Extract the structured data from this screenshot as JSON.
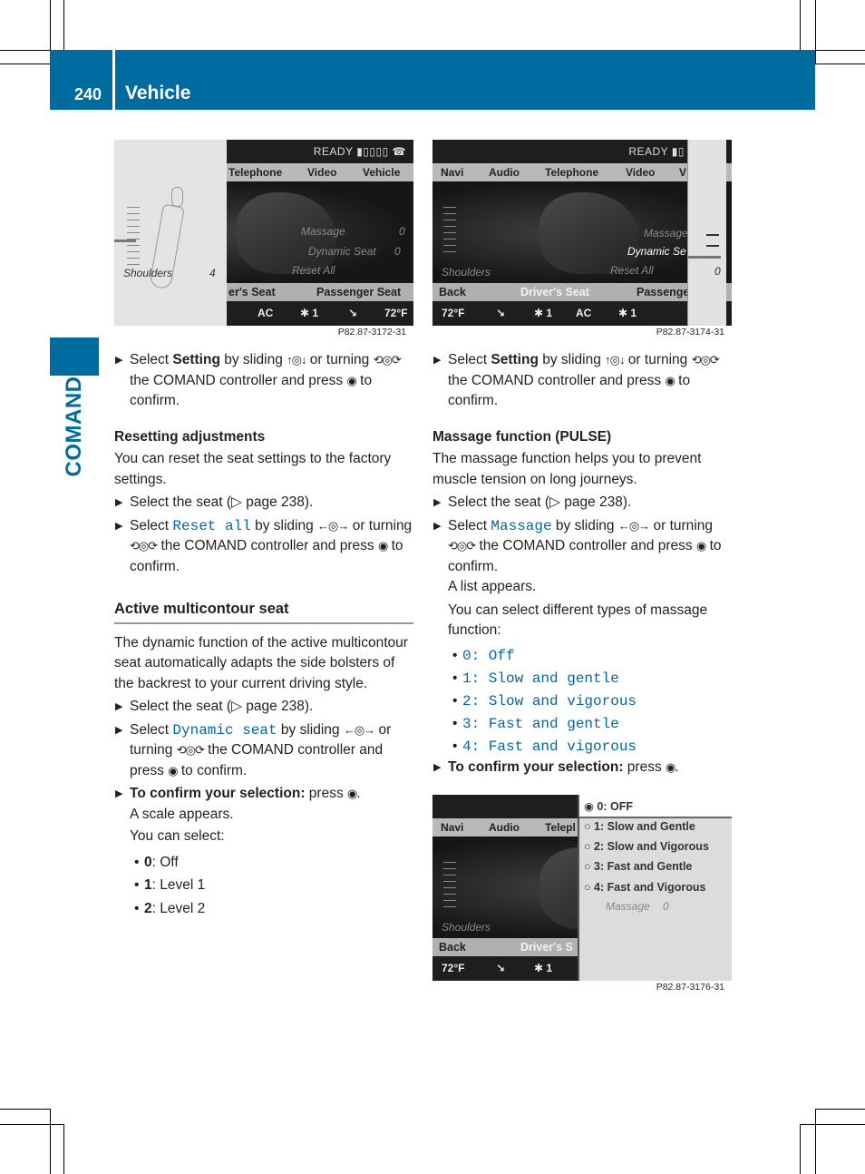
{
  "header": {
    "page_number": "240",
    "section_title": "Vehicle",
    "side_tab_label": "COMAND",
    "accent_color": "#006b9f",
    "link_color": "#0068a0"
  },
  "figures": {
    "fig1": {
      "caption": "P82.87-3172-31",
      "status": "READY",
      "menu": [
        "Telephone",
        "Video",
        "Vehicle"
      ],
      "overlay_label": "Shoulders",
      "overlay_value": "4",
      "items": [
        {
          "label": "Massage",
          "value": "0"
        },
        {
          "label": "Dynamic Seat",
          "value": "0"
        },
        {
          "label": "Reset All",
          "value": ""
        }
      ],
      "seat_bar": [
        "er's Seat",
        "Passenger Seat"
      ],
      "climate": [
        "AC",
        "✱ 1",
        "72°F"
      ]
    },
    "fig2": {
      "caption": "P82.87-3174-31",
      "status": "READY",
      "menu": [
        "Navi",
        "Audio",
        "Telephone",
        "Video",
        "V"
      ],
      "shoulders_label": "Shoulders",
      "items": [
        {
          "label": "Massage",
          "value": ""
        },
        {
          "label": "Dynamic Se",
          "value": ""
        },
        {
          "label": "Reset All",
          "value": ""
        }
      ],
      "overlay_value": "0",
      "seat_bar": [
        "Back",
        "Driver's Seat",
        "Passenge"
      ],
      "climate": [
        "72°F",
        "✱ 1",
        "AC",
        "✱ 1"
      ]
    },
    "fig3": {
      "caption": "P82.87-3176-31",
      "menu": [
        "Navi",
        "Audio",
        "Telepl"
      ],
      "shoulders_label": "Shoulders",
      "seat_bar": [
        "Back",
        "Driver's S"
      ],
      "climate": [
        "72°F",
        "✱ 1"
      ],
      "options": [
        {
          "label": "0: OFF",
          "selected": true
        },
        {
          "label": "1: Slow and Gentle",
          "selected": false
        },
        {
          "label": "2: Slow and Vigorous",
          "selected": false
        },
        {
          "label": "3: Fast and Gentle",
          "selected": false
        },
        {
          "label": "4: Fast and Vigorous",
          "selected": false
        }
      ],
      "footer_label": "Massage",
      "footer_value": "0"
    }
  },
  "left": {
    "step1": {
      "pre": "Select ",
      "bold": "Setting",
      "mid": " by sliding ",
      "after": " or turning ",
      "line2": " the COMAND controller and press ",
      "end": " to confirm."
    },
    "reset_heading": "Resetting adjustments",
    "reset_intro": "You can reset the seat settings to the factory settings.",
    "reset_step1": "Select the seat (▷ page 238).",
    "reset_step2": {
      "pre": "Select ",
      "code": "Reset all",
      "mid": " by sliding ",
      "after": " or turning ",
      "line2": " the COMAND controller and press ",
      "end": " to confirm."
    },
    "amc_heading": "Active multicontour seat",
    "amc_intro": "The dynamic function of the active multicontour seat automatically adapts the side bolsters of the backrest to your current driving style.",
    "amc_step1": "Select the seat (▷ page 238).",
    "amc_step2": {
      "pre": "Select ",
      "code": "Dynamic seat",
      "mid": " by sliding ",
      "after": " or turning ",
      "line2": " the COMAND controller and press ",
      "end": " to confirm."
    },
    "amc_confirm": {
      "bold": "To confirm your selection:",
      "rest": " press "
    },
    "scale_appears": "A scale appears.",
    "you_can_select": "You can select:",
    "levels": [
      {
        "key": "0",
        "text": ": Off"
      },
      {
        "key": "1",
        "text": ": Level 1"
      },
      {
        "key": "2",
        "text": ": Level 2"
      }
    ]
  },
  "right": {
    "step1": {
      "pre": "Select ",
      "bold": "Setting",
      "mid": " by sliding ",
      "after": " or turning ",
      "line2": " the COMAND controller and press ",
      "end": " to confirm."
    },
    "massage_heading": "Massage function (PULSE)",
    "massage_intro": "The massage function helps you to prevent muscle tension on long journeys.",
    "step_seat": "Select the seat (▷ page 238).",
    "step_massage": {
      "pre": "Select ",
      "code": "Massage",
      "mid": " by sliding ",
      "after": " or turning ",
      "line2": " the COMAND controller and press ",
      "end": " to confirm."
    },
    "list_appears": "A list appears.",
    "select_types": "You can select different types of massage function:",
    "options": [
      "0: Off",
      "1: Slow and gentle",
      "2: Slow and vigorous",
      "3: Fast and gentle",
      "4: Fast and vigorous"
    ],
    "confirm": {
      "bold": "To confirm your selection:",
      "rest": " press "
    }
  },
  "icons": {
    "slide_updown": "↑◎↓",
    "slide_leftright": "←◎→",
    "turn": "⟲◎⟳",
    "press": "◉",
    "step_arrow": "▶",
    "bullet": "•"
  }
}
